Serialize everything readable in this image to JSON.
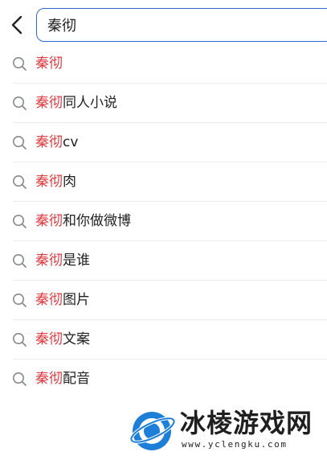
{
  "search": {
    "query": "秦彻"
  },
  "suggestions": [
    {
      "match": "秦彻",
      "rest": ""
    },
    {
      "match": "秦彻",
      "rest": "同人小说"
    },
    {
      "match": "秦彻",
      "rest": "cv"
    },
    {
      "match": "秦彻",
      "rest": "肉"
    },
    {
      "match": "秦彻",
      "rest": "和你做微博"
    },
    {
      "match": "秦彻",
      "rest": "是谁"
    },
    {
      "match": "秦彻",
      "rest": "图片"
    },
    {
      "match": "秦彻",
      "rest": "文案"
    },
    {
      "match": "秦彻",
      "rest": "配音"
    }
  ],
  "icons": {
    "back": "chevron-left-icon",
    "suggestion": "search-icon"
  },
  "colors": {
    "accent_border": "#2f6bd6",
    "highlight": "#e0393e",
    "text": "#222222",
    "divider": "#ececec"
  },
  "watermark": {
    "title": "冰棱游戏网",
    "url": "www.yclengku.com"
  }
}
